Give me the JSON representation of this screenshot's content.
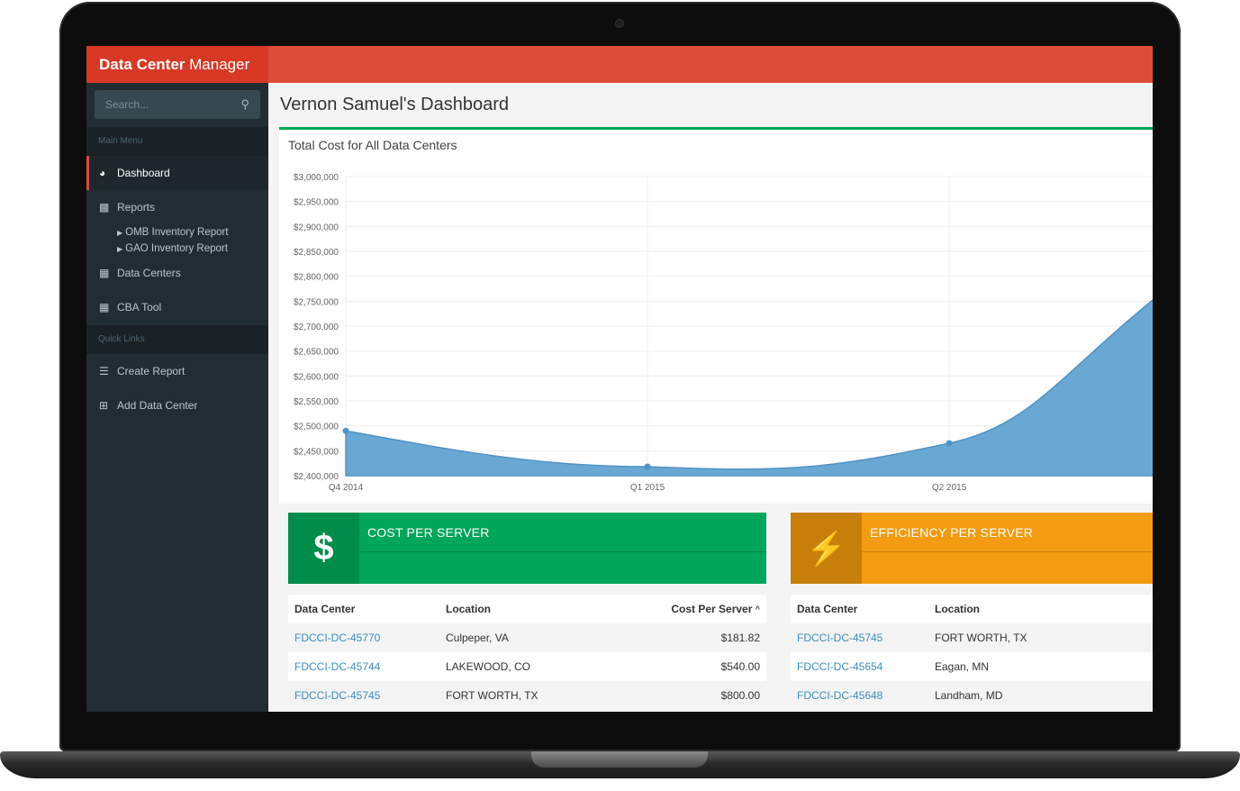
{
  "app": {
    "title_bold": "Data Center",
    "title_rest": " Manager"
  },
  "search": {
    "placeholder": "Search..."
  },
  "sidebar": {
    "main_menu_header": "Main Menu",
    "quick_links_header": "Quick Links",
    "items": [
      {
        "label": "Dashboard",
        "icon": "dashboard-icon"
      },
      {
        "label": "Reports",
        "icon": "bar-chart-icon"
      },
      {
        "label": "Data Centers",
        "icon": "table-icon"
      },
      {
        "label": "CBA Tool",
        "icon": "calculator-icon"
      }
    ],
    "report_subitems": [
      "OMB Inventory Report",
      "GAO Inventory Report"
    ],
    "quick_links": [
      {
        "label": "Create Report",
        "icon": "sliders-icon"
      },
      {
        "label": "Add Data Center",
        "icon": "plus-square-icon"
      }
    ]
  },
  "page": {
    "title": "Vernon Samuel's Dashboard"
  },
  "chart_data": {
    "type": "area",
    "title": "Total Cost for All Data Centers",
    "categories": [
      "Q4 2014",
      "Q1 2015",
      "Q2 2015"
    ],
    "y_ticks": [
      "$3,000,000",
      "$2,950,000",
      "$2,900,000",
      "$2,850,000",
      "$2,800,000",
      "$2,750,000",
      "$2,700,000",
      "$2,650,000",
      "$2,600,000",
      "$2,550,000",
      "$2,500,000",
      "$2,450,000",
      "$2,400,000"
    ],
    "ylim": [
      2400000,
      3000000
    ],
    "series": [
      {
        "points": [
          [
            0,
            2490000
          ],
          [
            1,
            2418000
          ],
          [
            2,
            2465000
          ],
          [
            2.68,
            2755000
          ]
        ]
      }
    ],
    "color": "#6aa8d4",
    "grid": true
  },
  "cost_box": {
    "label": "COST PER SERVER",
    "icon": "dollar-icon",
    "icon_glyph": "$",
    "color": "#00a65a"
  },
  "efficiency_box": {
    "label": "EFFICIENCY PER SERVER",
    "icon": "bolt-icon",
    "icon_glyph": "⚡",
    "color": "#f39c12"
  },
  "cost_table": {
    "headers": [
      "Data Center",
      "Location",
      "Cost Per Server"
    ],
    "sort_indicator": "^",
    "rows": [
      [
        "FDCCI-DC-45770",
        "Culpeper, VA",
        "$181.82"
      ],
      [
        "FDCCI-DC-45744",
        "LAKEWOOD, CO",
        "$540.00"
      ],
      [
        "FDCCI-DC-45745",
        "FORT WORTH, TX",
        "$800.00"
      ]
    ]
  },
  "efficiency_table": {
    "headers": [
      "Data Center",
      "Location"
    ],
    "rows": [
      [
        "FDCCI-DC-45745",
        "FORT WORTH, TX"
      ],
      [
        "FDCCI-DC-45654",
        "Eagan, MN"
      ],
      [
        "FDCCI-DC-45648",
        "Landham, MD"
      ]
    ]
  }
}
